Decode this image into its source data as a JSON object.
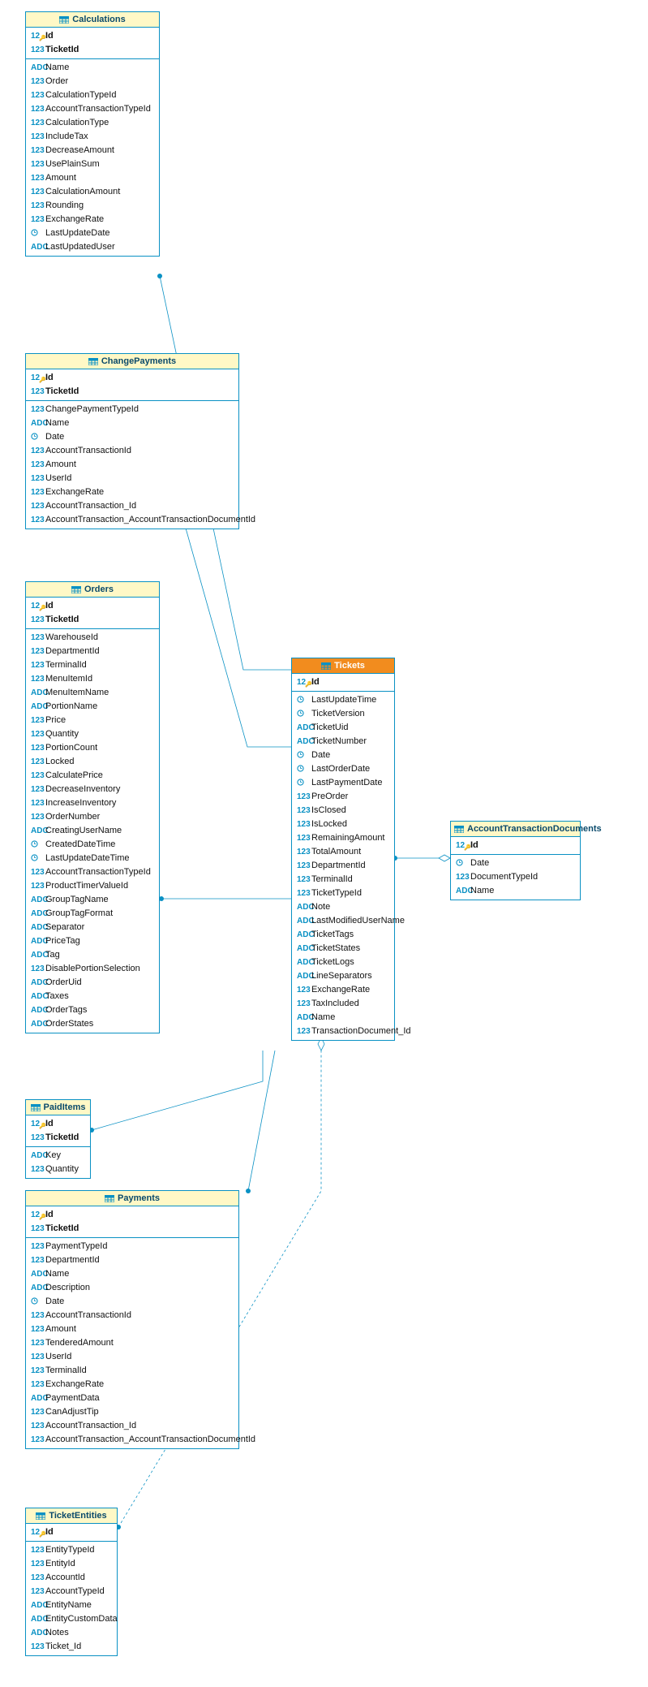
{
  "tables": {
    "calculations": {
      "title": "Calculations",
      "keys": [
        {
          "type": "pk",
          "name": "Id"
        },
        {
          "type": "num",
          "name": "TicketId"
        }
      ],
      "cols": [
        {
          "type": "txt",
          "name": "Name"
        },
        {
          "type": "num",
          "name": "Order"
        },
        {
          "type": "num",
          "name": "CalculationTypeId"
        },
        {
          "type": "num",
          "name": "AccountTransactionTypeId"
        },
        {
          "type": "num",
          "name": "CalculationType"
        },
        {
          "type": "num",
          "name": "IncludeTax"
        },
        {
          "type": "num",
          "name": "DecreaseAmount"
        },
        {
          "type": "num",
          "name": "UsePlainSum"
        },
        {
          "type": "num",
          "name": "Amount"
        },
        {
          "type": "num",
          "name": "CalculationAmount"
        },
        {
          "type": "num",
          "name": "Rounding"
        },
        {
          "type": "num",
          "name": "ExchangeRate"
        },
        {
          "type": "date",
          "name": "LastUpdateDate"
        },
        {
          "type": "txt",
          "name": "LastUpdatedUser"
        }
      ]
    },
    "changepayments": {
      "title": "ChangePayments",
      "keys": [
        {
          "type": "pk",
          "name": "Id"
        },
        {
          "type": "num",
          "name": "TicketId"
        }
      ],
      "cols": [
        {
          "type": "num",
          "name": "ChangePaymentTypeId"
        },
        {
          "type": "txt",
          "name": "Name"
        },
        {
          "type": "date",
          "name": "Date"
        },
        {
          "type": "num",
          "name": "AccountTransactionId"
        },
        {
          "type": "num",
          "name": "Amount"
        },
        {
          "type": "num",
          "name": "UserId"
        },
        {
          "type": "num",
          "name": "ExchangeRate"
        },
        {
          "type": "num",
          "name": "AccountTransaction_Id"
        },
        {
          "type": "num",
          "name": "AccountTransaction_AccountTransactionDocumentId"
        }
      ]
    },
    "orders": {
      "title": "Orders",
      "keys": [
        {
          "type": "pk",
          "name": "Id"
        },
        {
          "type": "num",
          "name": "TicketId"
        }
      ],
      "cols": [
        {
          "type": "num",
          "name": "WarehouseId"
        },
        {
          "type": "num",
          "name": "DepartmentId"
        },
        {
          "type": "num",
          "name": "TerminalId"
        },
        {
          "type": "num",
          "name": "MenuItemId"
        },
        {
          "type": "txt",
          "name": "MenuItemName"
        },
        {
          "type": "txt",
          "name": "PortionName"
        },
        {
          "type": "num",
          "name": "Price"
        },
        {
          "type": "num",
          "name": "Quantity"
        },
        {
          "type": "num",
          "name": "PortionCount"
        },
        {
          "type": "num",
          "name": "Locked"
        },
        {
          "type": "num",
          "name": "CalculatePrice"
        },
        {
          "type": "num",
          "name": "DecreaseInventory"
        },
        {
          "type": "num",
          "name": "IncreaseInventory"
        },
        {
          "type": "num",
          "name": "OrderNumber"
        },
        {
          "type": "txt",
          "name": "CreatingUserName"
        },
        {
          "type": "date",
          "name": "CreatedDateTime"
        },
        {
          "type": "date",
          "name": "LastUpdateDateTime"
        },
        {
          "type": "num",
          "name": "AccountTransactionTypeId"
        },
        {
          "type": "num",
          "name": "ProductTimerValueId"
        },
        {
          "type": "txt",
          "name": "GroupTagName"
        },
        {
          "type": "txt",
          "name": "GroupTagFormat"
        },
        {
          "type": "txt",
          "name": "Separator"
        },
        {
          "type": "txt",
          "name": "PriceTag"
        },
        {
          "type": "txt",
          "name": "Tag"
        },
        {
          "type": "num",
          "name": "DisablePortionSelection"
        },
        {
          "type": "txt",
          "name": "OrderUid"
        },
        {
          "type": "txt",
          "name": "Taxes"
        },
        {
          "type": "txt",
          "name": "OrderTags"
        },
        {
          "type": "txt",
          "name": "OrderStates"
        }
      ]
    },
    "paiditems": {
      "title": "PaidItems",
      "keys": [
        {
          "type": "pk",
          "name": "Id"
        },
        {
          "type": "num",
          "name": "TicketId"
        }
      ],
      "cols": [
        {
          "type": "txt",
          "name": "Key"
        },
        {
          "type": "num",
          "name": "Quantity"
        }
      ]
    },
    "payments": {
      "title": "Payments",
      "keys": [
        {
          "type": "pk",
          "name": "Id"
        },
        {
          "type": "num",
          "name": "TicketId"
        }
      ],
      "cols": [
        {
          "type": "num",
          "name": "PaymentTypeId"
        },
        {
          "type": "num",
          "name": "DepartmentId"
        },
        {
          "type": "txt",
          "name": "Name"
        },
        {
          "type": "txt",
          "name": "Description"
        },
        {
          "type": "date",
          "name": "Date"
        },
        {
          "type": "num",
          "name": "AccountTransactionId"
        },
        {
          "type": "num",
          "name": "Amount"
        },
        {
          "type": "num",
          "name": "TenderedAmount"
        },
        {
          "type": "num",
          "name": "UserId"
        },
        {
          "type": "num",
          "name": "TerminalId"
        },
        {
          "type": "num",
          "name": "ExchangeRate"
        },
        {
          "type": "txt",
          "name": "PaymentData"
        },
        {
          "type": "num",
          "name": "CanAdjustTip"
        },
        {
          "type": "num",
          "name": "AccountTransaction_Id"
        },
        {
          "type": "num",
          "name": "AccountTransaction_AccountTransactionDocumentId"
        }
      ]
    },
    "ticketentities": {
      "title": "TicketEntities",
      "keys": [
        {
          "type": "pk",
          "name": "Id"
        }
      ],
      "cols": [
        {
          "type": "num",
          "name": "EntityTypeId"
        },
        {
          "type": "num",
          "name": "EntityId"
        },
        {
          "type": "num",
          "name": "AccountId"
        },
        {
          "type": "num",
          "name": "AccountTypeId"
        },
        {
          "type": "txt",
          "name": "EntityName"
        },
        {
          "type": "txt",
          "name": "EntityCustomData"
        },
        {
          "type": "txt",
          "name": "Notes"
        },
        {
          "type": "num",
          "name": "Ticket_Id"
        }
      ]
    },
    "tickets": {
      "title": "Tickets",
      "highlight": true,
      "keys": [
        {
          "type": "pk",
          "name": "Id"
        }
      ],
      "cols": [
        {
          "type": "date",
          "name": "LastUpdateTime"
        },
        {
          "type": "date",
          "name": "TicketVersion"
        },
        {
          "type": "txt",
          "name": "TicketUid"
        },
        {
          "type": "txt",
          "name": "TicketNumber"
        },
        {
          "type": "date",
          "name": "Date"
        },
        {
          "type": "date",
          "name": "LastOrderDate"
        },
        {
          "type": "date",
          "name": "LastPaymentDate"
        },
        {
          "type": "num",
          "name": "PreOrder"
        },
        {
          "type": "num",
          "name": "IsClosed"
        },
        {
          "type": "num",
          "name": "IsLocked"
        },
        {
          "type": "num",
          "name": "RemainingAmount"
        },
        {
          "type": "num",
          "name": "TotalAmount"
        },
        {
          "type": "num",
          "name": "DepartmentId"
        },
        {
          "type": "num",
          "name": "TerminalId"
        },
        {
          "type": "num",
          "name": "TicketTypeId"
        },
        {
          "type": "txt",
          "name": "Note"
        },
        {
          "type": "txt",
          "name": "LastModifiedUserName"
        },
        {
          "type": "txt",
          "name": "TicketTags"
        },
        {
          "type": "txt",
          "name": "TicketStates"
        },
        {
          "type": "txt",
          "name": "TicketLogs"
        },
        {
          "type": "txt",
          "name": "LineSeparators"
        },
        {
          "type": "num",
          "name": "ExchangeRate"
        },
        {
          "type": "num",
          "name": "TaxIncluded"
        },
        {
          "type": "txt",
          "name": "Name"
        },
        {
          "type": "num",
          "name": "TransactionDocument_Id"
        }
      ]
    },
    "atd": {
      "title": "AccountTransactionDocuments",
      "keys": [
        {
          "type": "pk",
          "name": "Id"
        }
      ],
      "cols": [
        {
          "type": "date",
          "name": "Date"
        },
        {
          "type": "num",
          "name": "DocumentTypeId"
        },
        {
          "type": "txt",
          "name": "Name"
        }
      ]
    }
  }
}
